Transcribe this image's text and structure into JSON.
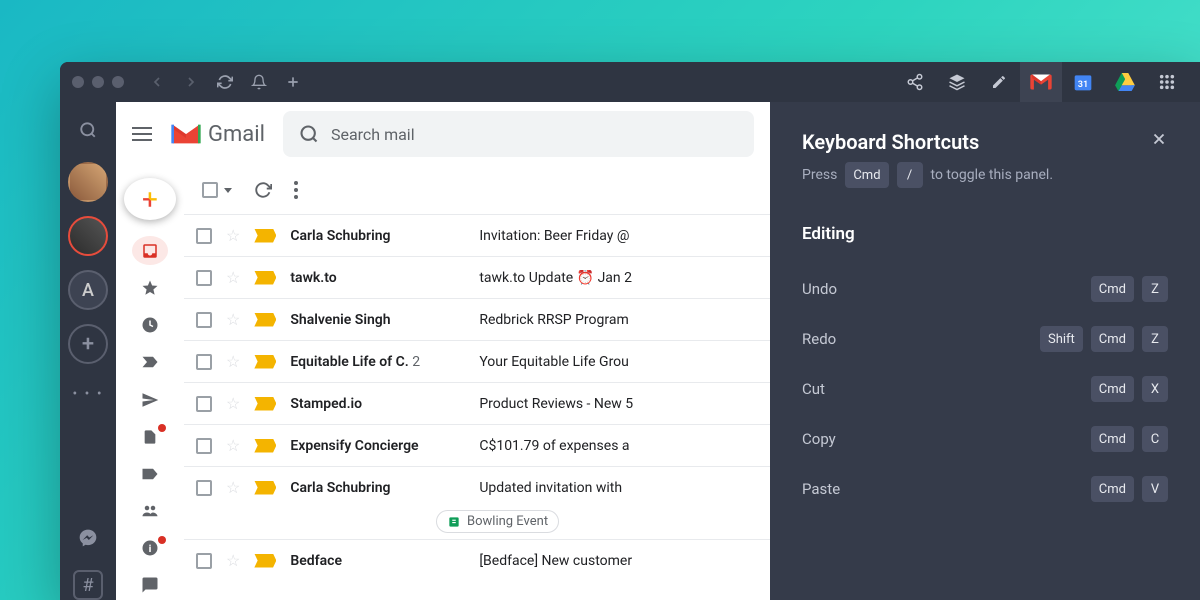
{
  "titlebar": {
    "apps": [
      "share",
      "layers",
      "pencil",
      "gmail",
      "calendar",
      "drive",
      "apps-grid"
    ]
  },
  "leftRail": {
    "avatars": [
      "user-1",
      "user-2",
      "A"
    ],
    "plusLabel": "+"
  },
  "gmail": {
    "title": "Gmail",
    "searchPlaceholder": "Search mail",
    "emails": [
      {
        "sender": "Carla Schubring",
        "count": "",
        "subject": "Invitation: Beer Friday @"
      },
      {
        "sender": "tawk.to",
        "count": "",
        "subject": "tawk.to Update ⏰ Jan 2"
      },
      {
        "sender": "Shalvenie Singh",
        "count": "",
        "subject": "Redbrick RRSP Program"
      },
      {
        "sender": "Equitable Life of C.",
        "count": "2",
        "subject": "Your Equitable Life Grou"
      },
      {
        "sender": "Stamped.io",
        "count": "",
        "subject": "Product Reviews - New 5"
      },
      {
        "sender": "Expensify Concierge",
        "count": "",
        "subject": "C$101.79 of expenses a"
      },
      {
        "sender": "Carla Schubring",
        "count": "",
        "subject": "Updated invitation with",
        "attachment": "Bowling Event"
      },
      {
        "sender": "Bedface",
        "count": "",
        "subject": "[Bedface] New customer"
      }
    ]
  },
  "shortcuts": {
    "title": "Keyboard Shortcuts",
    "hintPrefix": "Press",
    "hintKey1": "Cmd",
    "hintKey2": "/",
    "hintSuffix": "to toggle this panel.",
    "sectionTitle": "Editing",
    "rows": [
      {
        "action": "Undo",
        "keys": [
          "Cmd",
          "Z"
        ]
      },
      {
        "action": "Redo",
        "keys": [
          "Shift",
          "Cmd",
          "Z"
        ]
      },
      {
        "action": "Cut",
        "keys": [
          "Cmd",
          "X"
        ]
      },
      {
        "action": "Copy",
        "keys": [
          "Cmd",
          "C"
        ]
      },
      {
        "action": "Paste",
        "keys": [
          "Cmd",
          "V"
        ]
      }
    ]
  }
}
